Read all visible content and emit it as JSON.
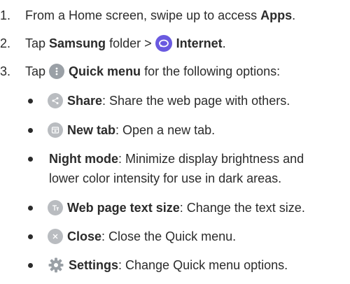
{
  "steps": [
    {
      "num": "1.",
      "pre": "From a Home screen, swipe up to access ",
      "bold": "Apps",
      "post": "."
    },
    {
      "num": "2.",
      "pre": "Tap ",
      "bold": "Samsung",
      "mid": " folder > ",
      "bold2": "Internet",
      "post": "."
    },
    {
      "num": "3.",
      "pre": "Tap ",
      "bold": "Quick menu",
      "post": " for the following options:"
    }
  ],
  "bullets": [
    {
      "bold": "Share",
      "text": ": Share the web page with others.",
      "icon": "share-icon"
    },
    {
      "bold": "New tab",
      "text": ": Open a new tab.",
      "icon": "new-tab-icon"
    },
    {
      "bold": "Night mode",
      "text": ": Minimize display brightness and",
      "text2": "lower color intensity for use in dark areas."
    },
    {
      "bold": "Web page text size",
      "text": ": Change the text size.",
      "icon": "text-size-icon"
    },
    {
      "bold": "Close",
      "text": ": Close the Quick menu.",
      "icon": "close-icon"
    },
    {
      "bold": "Settings",
      "text": ": Change Quick menu options.",
      "icon": "settings-icon"
    }
  ],
  "colors": {
    "text": "#2b2b2b",
    "icon_gray": "#b9bcc0",
    "internet_purple": "#6a5ae0",
    "settings_gray": "#9aa0a6"
  }
}
